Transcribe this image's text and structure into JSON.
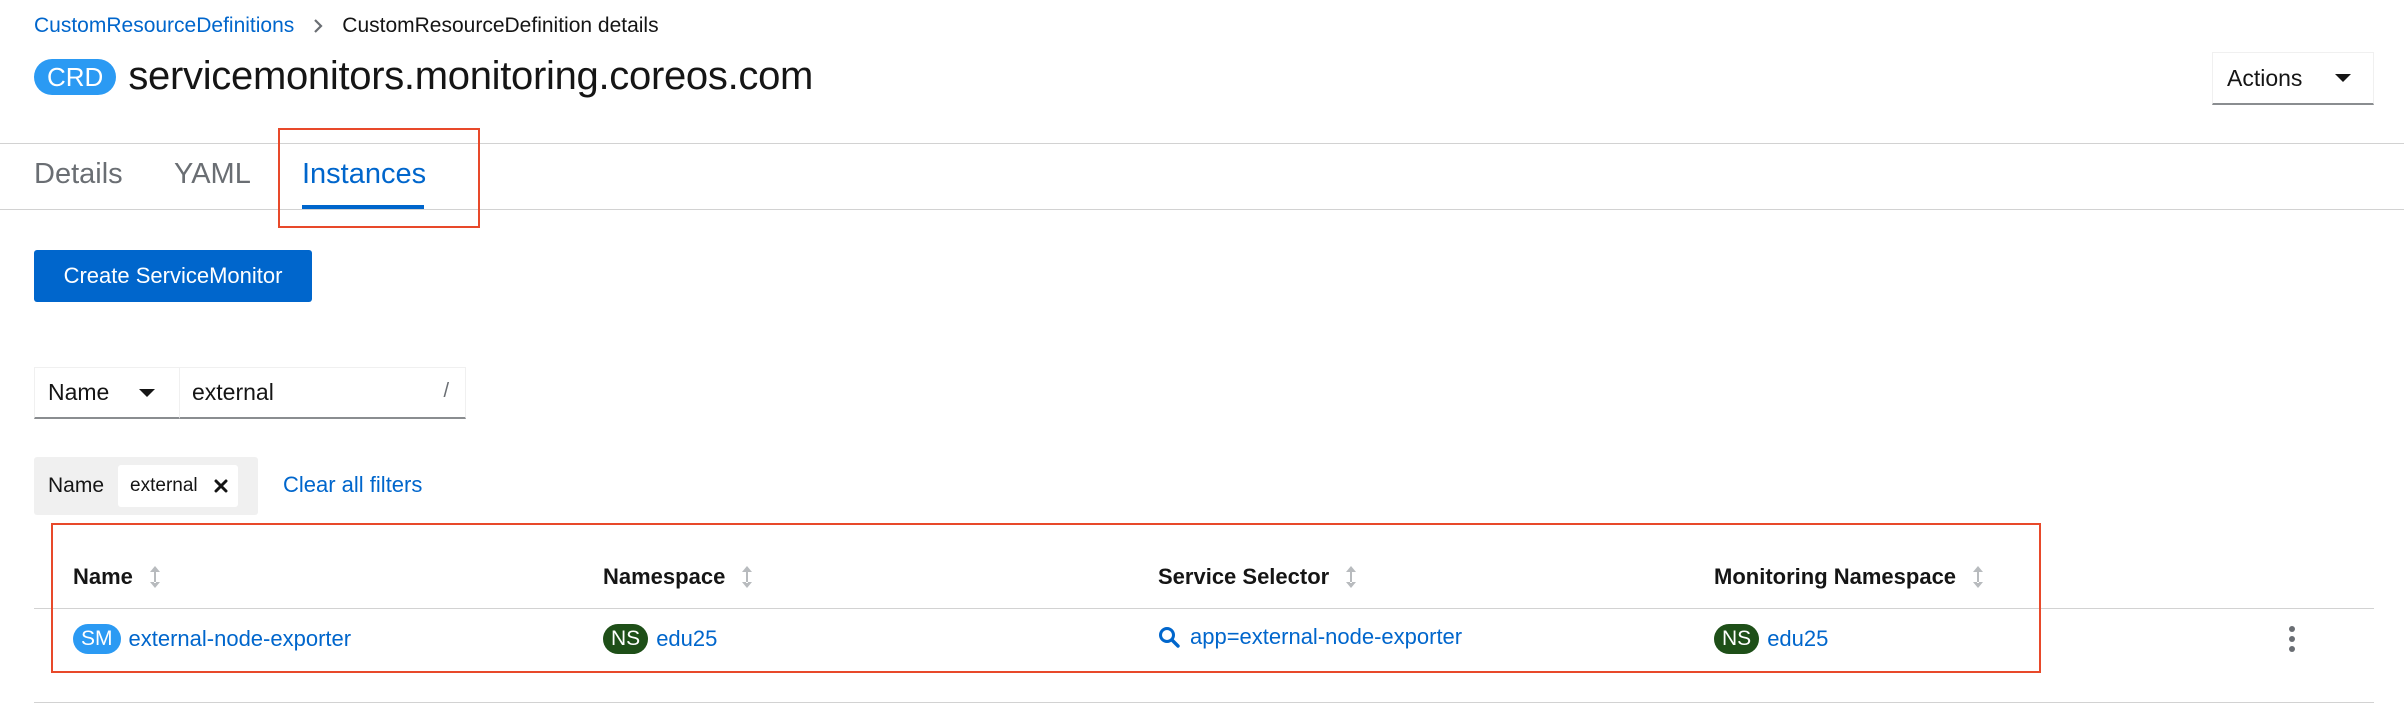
{
  "breadcrumb": {
    "parent": "CustomResourceDefinitions",
    "current": "CustomResourceDefinition details"
  },
  "header": {
    "badge": "CRD",
    "title": "servicemonitors.monitoring.coreos.com",
    "actions_label": "Actions"
  },
  "tabs": [
    {
      "label": "Details",
      "active": false
    },
    {
      "label": "YAML",
      "active": false
    },
    {
      "label": "Instances",
      "active": true
    }
  ],
  "create_button": "Create ServiceMonitor",
  "filter": {
    "type": "Name",
    "value": "external",
    "shortcut": "/"
  },
  "chips": {
    "category": "Name",
    "value": "external",
    "clear_all": "Clear all filters"
  },
  "table": {
    "columns": [
      "Name",
      "Namespace",
      "Service Selector",
      "Monitoring Namespace"
    ],
    "rows": [
      {
        "name_badge": "SM",
        "name": "external-node-exporter",
        "namespace_badge": "NS",
        "namespace": "edu25",
        "selector": "app=external-node-exporter",
        "monitoring_namespace_badge": "NS",
        "monitoring_namespace": "edu25"
      }
    ]
  },
  "colors": {
    "link": "#0066cc",
    "primary_button": "#0066cc",
    "crd_badge": "#2b9af3",
    "sm_badge": "#2b9af3",
    "ns_badge": "#1e4f18",
    "highlight_box": "#e8492a"
  },
  "icons": {
    "breadcrumb_separator": "chevron-right-icon",
    "actions_caret": "caret-down-icon",
    "filter_caret": "caret-down-icon",
    "chip_remove": "close-icon",
    "sort": "sort-icon",
    "selector": "search-icon",
    "row_actions": "kebab-icon"
  }
}
